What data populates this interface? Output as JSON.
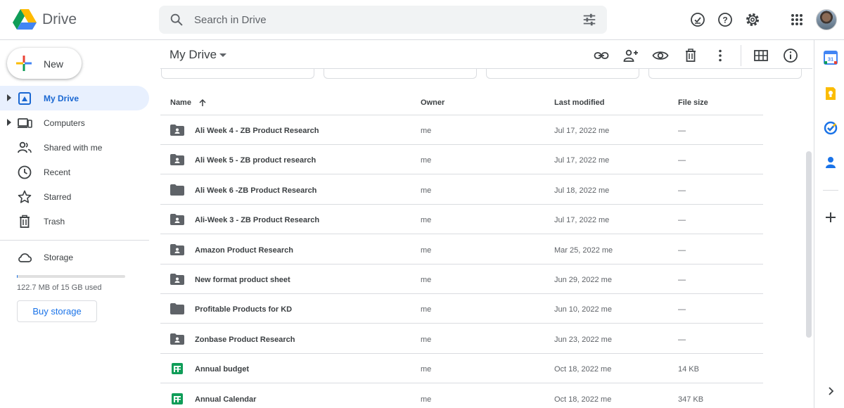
{
  "header": {
    "app_name": "Drive",
    "search_placeholder": "Search in Drive",
    "icons": [
      "search-icon",
      "search-options-icon",
      "ready-for-offline-icon",
      "help-icon",
      "settings-icon",
      "apps-icon",
      "account-avatar"
    ]
  },
  "sidebar": {
    "new_label": "New",
    "items": [
      {
        "label": "My Drive",
        "icon": "my-drive-icon",
        "active": true
      },
      {
        "label": "Computers",
        "icon": "computers-icon",
        "active": false
      },
      {
        "label": "Shared with me",
        "icon": "shared-icon",
        "active": false
      },
      {
        "label": "Recent",
        "icon": "clock-icon",
        "active": false
      },
      {
        "label": "Starred",
        "icon": "star-icon",
        "active": false
      },
      {
        "label": "Trash",
        "icon": "trash-icon",
        "active": false
      }
    ],
    "storage": {
      "label": "Storage",
      "used_text": "122.7 MB of 15 GB used",
      "used_fraction": 0.008,
      "buy_label": "Buy storage"
    }
  },
  "main": {
    "title": "My Drive",
    "toolbar_icons": [
      "link-icon",
      "share-icon",
      "preview-icon",
      "trash-icon",
      "more-icon",
      "grid-view-icon",
      "info-icon"
    ],
    "columns": {
      "name": "Name",
      "owner": "Owner",
      "modified": "Last modified",
      "size": "File size"
    },
    "rows": [
      {
        "name": "Ali Week 4 - ZB Product Research",
        "type": "shared-folder",
        "owner": "me",
        "modified": "Jul 17, 2022 me",
        "size": "—"
      },
      {
        "name": "Ali Week 5 - ZB product research",
        "type": "shared-folder",
        "owner": "me",
        "modified": "Jul 17, 2022 me",
        "size": "—"
      },
      {
        "name": "Ali Week 6 -ZB Product Research",
        "type": "folder",
        "owner": "me",
        "modified": "Jul 18, 2022 me",
        "size": "—"
      },
      {
        "name": "Ali-Week 3 - ZB Product Research",
        "type": "shared-folder",
        "owner": "me",
        "modified": "Jul 17, 2022 me",
        "size": "—"
      },
      {
        "name": "Amazon Product Research",
        "type": "shared-folder",
        "owner": "me",
        "modified": "Mar 25, 2022 me",
        "size": "—"
      },
      {
        "name": "New format product sheet",
        "type": "shared-folder",
        "owner": "me",
        "modified": "Jun 29, 2022 me",
        "size": "—"
      },
      {
        "name": "Profitable Products for KD",
        "type": "folder",
        "owner": "me",
        "modified": "Jun 10, 2022 me",
        "size": "—"
      },
      {
        "name": "Zonbase Product Research",
        "type": "shared-folder",
        "owner": "me",
        "modified": "Jun 23, 2022 me",
        "size": "—"
      },
      {
        "name": "Annual budget",
        "type": "spreadsheet",
        "owner": "me",
        "modified": "Oct 18, 2022 me",
        "size": "14 KB"
      },
      {
        "name": "Annual Calendar",
        "type": "spreadsheet",
        "owner": "me",
        "modified": "Oct 18, 2022 me",
        "size": "347 KB"
      }
    ]
  },
  "side_panel": {
    "calendar_day": "31",
    "icons": [
      "calendar-icon",
      "keep-icon",
      "tasks-icon",
      "contacts-icon",
      "add-icon",
      "chevron-right-icon"
    ]
  },
  "colors": {
    "accent": "#1a73e8",
    "active_bg": "#e8f0fe",
    "active_text": "#1967d2",
    "sheets_green": "#0f9d58",
    "folder_gray": "#5f6368"
  }
}
